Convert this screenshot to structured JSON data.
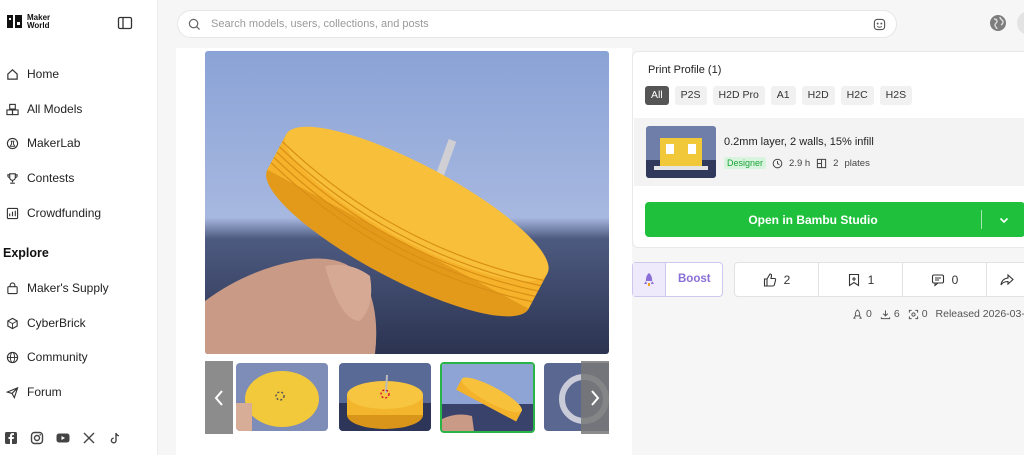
{
  "brand": {
    "line1": "Maker",
    "line2": "World"
  },
  "sidebar": {
    "items": [
      {
        "label": "Home",
        "icon": "home-icon"
      },
      {
        "label": "All Models",
        "icon": "cubes-icon"
      },
      {
        "label": "MakerLab",
        "icon": "lab-icon"
      },
      {
        "label": "Contests",
        "icon": "trophy-icon"
      },
      {
        "label": "Crowdfunding",
        "icon": "crowdfunding-icon"
      }
    ],
    "explore_title": "Explore",
    "explore_items": [
      {
        "label": "Maker's Supply",
        "icon": "bag-icon"
      },
      {
        "label": "CyberBrick",
        "icon": "brick-icon"
      },
      {
        "label": "Community",
        "icon": "globe-icon"
      },
      {
        "label": "Forum",
        "icon": "send-icon"
      }
    ],
    "socials": [
      "facebook-icon",
      "instagram-icon",
      "youtube-icon",
      "x-icon",
      "tiktok-icon"
    ]
  },
  "search": {
    "placeholder": "Search models, users, collections, and posts"
  },
  "print_profile": {
    "title": "Print Profile (1)",
    "filters": [
      "All",
      "P2S",
      "H2D Pro",
      "A1",
      "H2D",
      "H2C",
      "H2S"
    ],
    "active_filter": "All",
    "profile": {
      "name": "0.2mm layer, 2 walls, 15% infill",
      "badge": "Designer",
      "time": "2.9 h",
      "plates_count": "2",
      "plates_label": "plates"
    },
    "open_button": "Open in Bambu Studio"
  },
  "actions": {
    "boost": "Boost",
    "likes": "2",
    "collects": "1",
    "comments": "0"
  },
  "meta": {
    "boosts": "0",
    "downloads": "6",
    "prints": "0",
    "released": "Released 2026-03-"
  },
  "colors": {
    "accent": "#1fc13c",
    "boost": "#8a6fd6",
    "model": "#f6b52a"
  }
}
